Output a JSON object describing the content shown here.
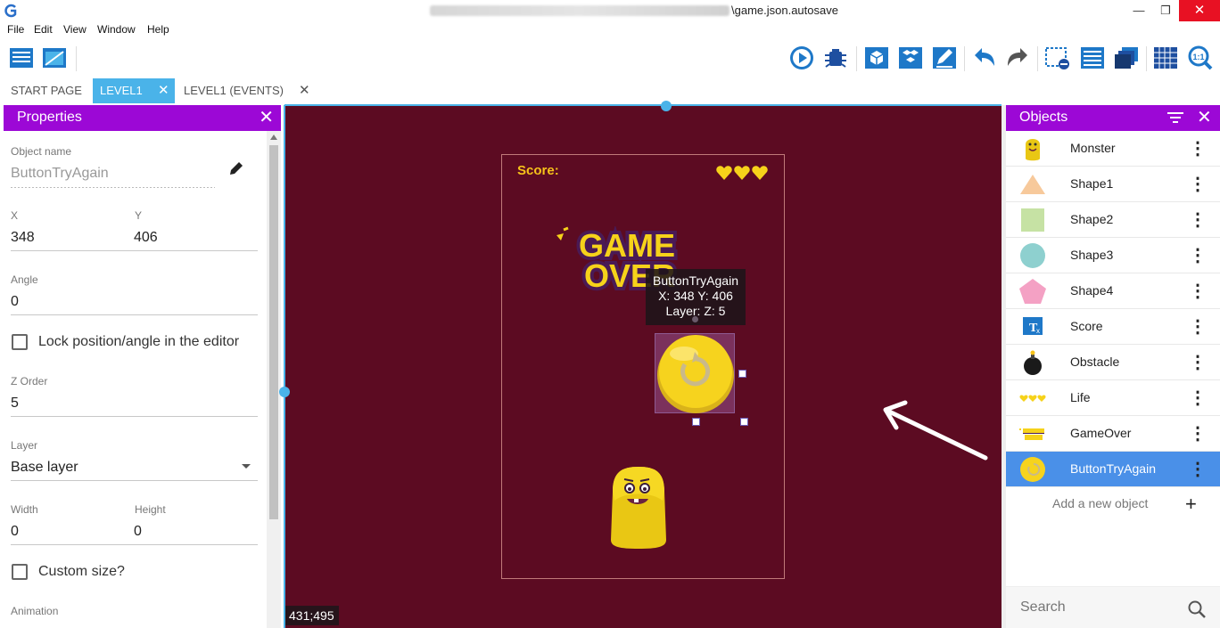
{
  "window": {
    "title_suffix": "\\game.json.autosave",
    "minimize": "—",
    "maximize": "❐",
    "close": "✕"
  },
  "menu": [
    "File",
    "Edit",
    "View",
    "Window",
    "Help"
  ],
  "tabs": {
    "start": "START PAGE",
    "level1": "LEVEL1",
    "events": "LEVEL1 (EVENTS)",
    "close_glyph": "✕"
  },
  "properties": {
    "title": "Properties",
    "object_name_label": "Object name",
    "object_name": "ButtonTryAgain",
    "x_label": "X",
    "x_value": "348",
    "y_label": "Y",
    "y_value": "406",
    "angle_label": "Angle",
    "angle_value": "0",
    "lock_label": "Lock position/angle in the editor",
    "z_order_label": "Z Order",
    "z_order_value": "5",
    "layer_label": "Layer",
    "layer_value": "Base layer",
    "width_label": "Width",
    "width_value": "0",
    "height_label": "Height",
    "height_value": "0",
    "custom_size_label": "Custom size?",
    "animation_label": "Animation"
  },
  "canvas": {
    "score_label": "Score:",
    "game_over_line1": "GAME",
    "game_over_line2": "OVER",
    "tooltip": {
      "name": "ButtonTryAgain",
      "pos": "X: 348  Y: 406",
      "layer": "Layer:   Z: 5"
    },
    "cursor_coords": "431;495",
    "background_color": "#5c0b22"
  },
  "objects": {
    "title": "Objects",
    "items": [
      {
        "name": "Monster",
        "icon": "monster-icon"
      },
      {
        "name": "Shape1",
        "icon": "triangle-icon"
      },
      {
        "name": "Shape2",
        "icon": "square-icon"
      },
      {
        "name": "Shape3",
        "icon": "circle-icon"
      },
      {
        "name": "Shape4",
        "icon": "pentagon-icon"
      },
      {
        "name": "Score",
        "icon": "text-icon"
      },
      {
        "name": "Obstacle",
        "icon": "bomb-icon"
      },
      {
        "name": "Life",
        "icon": "hearts-icon"
      },
      {
        "name": "GameOver",
        "icon": "game-over-icon"
      },
      {
        "name": "ButtonTryAgain",
        "icon": "retry-button-icon",
        "selected": true
      }
    ],
    "add_label": "Add a new object",
    "search_placeholder": "Search"
  },
  "colors": {
    "panel_header": "#9c08d6",
    "accent_blue": "#4ab3e9",
    "selected_row": "#4a90e8"
  }
}
